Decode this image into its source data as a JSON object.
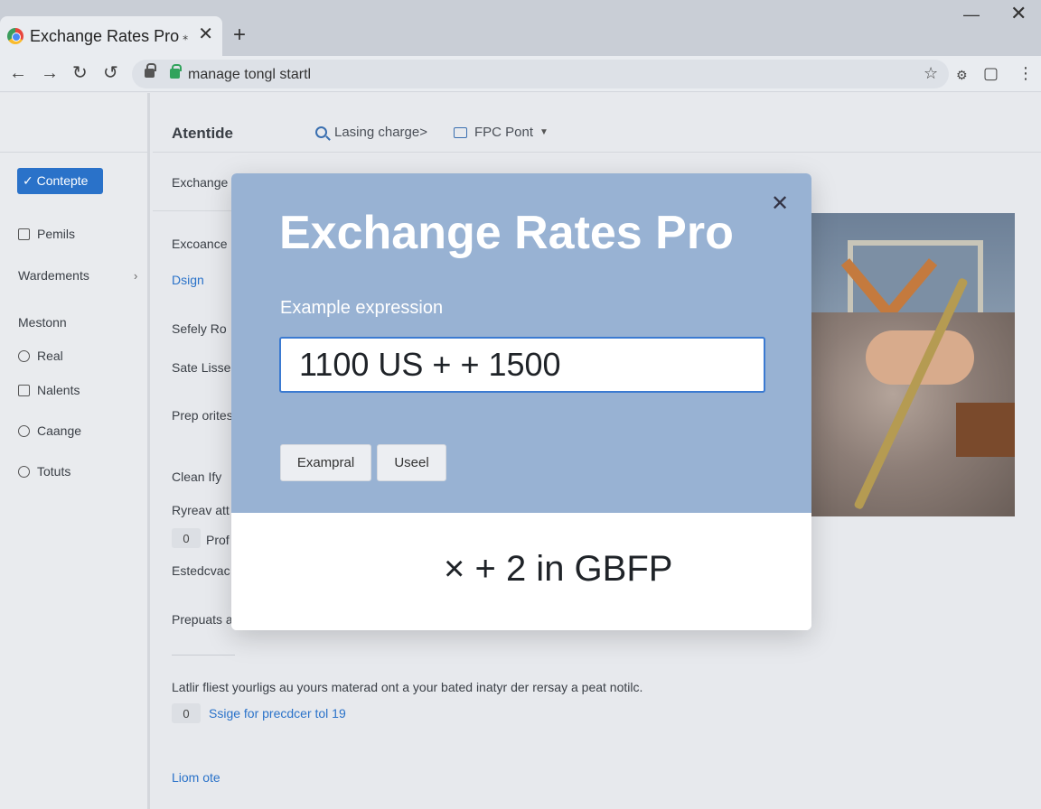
{
  "browser": {
    "tab_title": "Exchange Rates Pro",
    "tab_pin": "⁎",
    "close_tab": "✕",
    "new_tab": "+",
    "url": "manage tongl startl",
    "icons": [
      "back-icon",
      "forward-icon",
      "reload-icon",
      "refresh-icon",
      "lock-icon",
      "secure-icon",
      "star-icon",
      "extension-icon",
      "sidepanel-icon",
      "menu-icon"
    ]
  },
  "header": {
    "app_title": "Atentide",
    "search_label": "Lasing charge>",
    "font_label": "FPC Pont"
  },
  "sidebar": {
    "primary_button": "✓ Contepte",
    "items": [
      {
        "label": "Pemils"
      },
      {
        "label": "Wardements"
      },
      {
        "heading": "Mestonn"
      },
      {
        "label": "Real"
      },
      {
        "label": "Nalents"
      },
      {
        "label": "Caange"
      },
      {
        "label": "Totuts"
      }
    ]
  },
  "main": {
    "exchange_label": "Exchange",
    "rows": [
      "Excoance",
      "Dsign",
      "Sefely Ro",
      "Sate Lisse",
      "Prep orites",
      "Clean Ify",
      "Ryreav att",
      "Prof",
      "Estedcvac",
      "Prepuats a"
    ],
    "badge_values": [
      "0",
      "0"
    ],
    "footer_text": "Latlir fliest yourligs au yours materad ont a your bated inatyr der rersay a peat notilc.",
    "footer_link": "Ssige for precdcer tol 19",
    "bottom_link": "Liom ote"
  },
  "modal": {
    "title": "Exchange Rates Pro",
    "field_label": "Example expression",
    "input_value": "1100 US + + 1500",
    "button1": "Exampral",
    "button2": "Useel",
    "close": "✕",
    "result": "× + 2 in GBFP"
  },
  "colors": {
    "accent": "#2a72c9",
    "modal_bg": "#98b2d3",
    "input_border": "#3b7ad1"
  }
}
